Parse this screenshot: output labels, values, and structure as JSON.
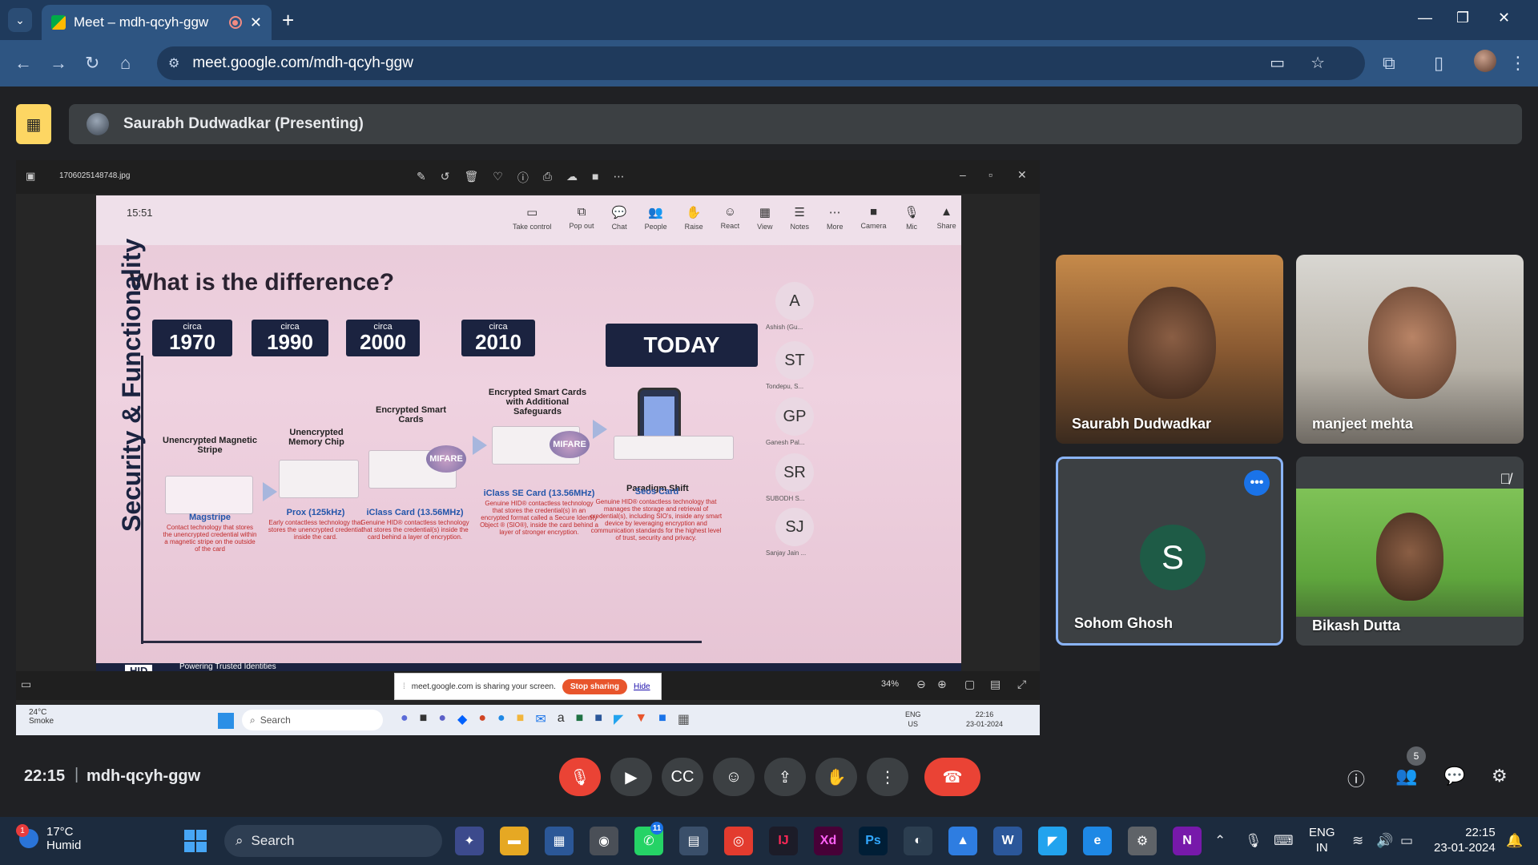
{
  "browser": {
    "tab_title": "Meet – mdh-qcyh-ggw",
    "url": "meet.google.com/mdh-qcyh-ggw"
  },
  "meet": {
    "presenter_label": "Saurabh Dudwadkar (Presenting)",
    "time": "22:15",
    "meeting_code": "mdh-qcyh-ggw",
    "participants_count": "5",
    "tiles": [
      {
        "name": "Saurabh Dudwadkar"
      },
      {
        "name": "manjeet mehta"
      },
      {
        "name": "Sohom Ghosh",
        "initial": "S"
      },
      {
        "name": "Bikash Dutta"
      }
    ]
  },
  "shared_screen": {
    "file_name": "1706025148748.jpg",
    "zoom": "34%",
    "share_notice": "meet.google.com is sharing your screen.",
    "stop_sharing": "Stop sharing",
    "hide": "Hide",
    "photo_clock": "15:51",
    "teams_tools": [
      "Take control",
      "Pop out",
      "Chat",
      "People",
      "Raise",
      "React",
      "View",
      "Notes",
      "More",
      "Camera",
      "Mic",
      "Share"
    ],
    "slide": {
      "title": "What is the difference?",
      "circa": "circa",
      "eras": [
        "1970",
        "1990",
        "2000",
        "2010"
      ],
      "today": "TODAY",
      "y_axis": "Security & Functionality",
      "stages": [
        {
          "head": "Unencrypted Magnetic Stripe",
          "foot": "Magstripe",
          "desc": "Contact technology that stores the unencrypted credential within a magnetic stripe on the outside of the card"
        },
        {
          "head": "Unencrypted Memory Chip",
          "foot": "Prox (125kHz)",
          "desc": "Early contactless technology that stores the unencrypted credential inside the card."
        },
        {
          "head": "Encrypted Smart Cards",
          "foot": "iClass Card (13.56MHz)",
          "desc": "Genuine HID® contactless technology that stores the credential(s) inside the card behind a layer of encryption."
        },
        {
          "head": "Encrypted Smart Cards with Additional Safeguards",
          "foot": "iClass SE Card (13.56MHz)",
          "desc": "Genuine HID® contactless technology that stores the credential(s) in an encrypted format called a Secure Identity Object ® (SIO®), inside the card behind a layer of stronger encryption."
        },
        {
          "head": "",
          "foot": "Seos Card",
          "desc": "Genuine HID® contactless technology that manages the storage and retrieval of credential(s), including SIO's, inside any smart device by leveraging encryption and communication standards for the highest level of trust, security and privacy."
        }
      ],
      "paradigm": "Paradigm Shift",
      "mifare": "MIFARE",
      "hid": "HID",
      "hid_tag": "Powering Trusted Identities",
      "participants": [
        {
          "initials": "A",
          "name": "Ashish (Gu..."
        },
        {
          "initials": "ST",
          "name": "Tondepu, S..."
        },
        {
          "initials": "GP",
          "name": "Ganesh Pal..."
        },
        {
          "initials": "SR",
          "name": "SUBODH S..."
        },
        {
          "initials": "SJ",
          "name": "Sanjay Jain ..."
        }
      ]
    },
    "inner_taskbar": {
      "weather_temp": "24°C",
      "weather_desc": "Smoke",
      "search": "Search",
      "lang1": "ENG",
      "lang2": "US",
      "time": "22:16",
      "date": "23-01-2024"
    }
  },
  "taskbar": {
    "weather_temp": "17°C",
    "weather_desc": "Humid",
    "weather_badge": "1",
    "search": "Search",
    "whatsapp_badge": "11",
    "lang1": "ENG",
    "lang2": "IN",
    "time": "22:15",
    "date": "23-01-2024"
  }
}
